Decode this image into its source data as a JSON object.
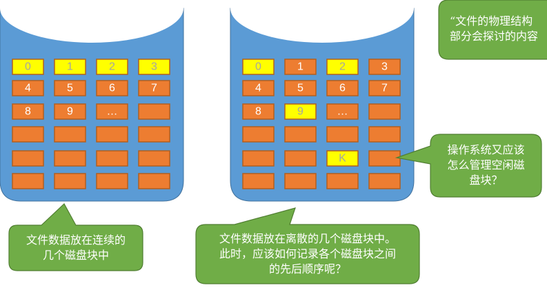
{
  "colors": {
    "disk": "#5b9bd5",
    "block_default": "#ed7d31",
    "block_highlight": "#ffff00",
    "text_on_highlight": "#a5a5a5",
    "text_on_default": "#ffffff",
    "callout": "#70ad47"
  },
  "disks": [
    {
      "name": "contiguous",
      "blocks": [
        {
          "label": "0",
          "highlight": true
        },
        {
          "label": "1",
          "highlight": true
        },
        {
          "label": "2",
          "highlight": true
        },
        {
          "label": "3",
          "highlight": true
        },
        {
          "label": "4",
          "highlight": false
        },
        {
          "label": "5",
          "highlight": false
        },
        {
          "label": "6",
          "highlight": false
        },
        {
          "label": "7",
          "highlight": false
        },
        {
          "label": "8",
          "highlight": false
        },
        {
          "label": "9",
          "highlight": false
        },
        {
          "label": "…",
          "highlight": false
        },
        {
          "label": "",
          "highlight": false
        },
        {
          "label": "",
          "highlight": false
        },
        {
          "label": "",
          "highlight": false
        },
        {
          "label": "",
          "highlight": false
        },
        {
          "label": "",
          "highlight": false
        },
        {
          "label": "",
          "highlight": false
        },
        {
          "label": "",
          "highlight": false
        },
        {
          "label": "",
          "highlight": false
        },
        {
          "label": "",
          "highlight": false
        },
        {
          "label": "",
          "highlight": false
        },
        {
          "label": "",
          "highlight": false
        },
        {
          "label": "",
          "highlight": false
        },
        {
          "label": "",
          "highlight": false
        }
      ]
    },
    {
      "name": "scattered",
      "blocks": [
        {
          "label": "0",
          "highlight": true
        },
        {
          "label": "1",
          "highlight": false
        },
        {
          "label": "2",
          "highlight": true
        },
        {
          "label": "3",
          "highlight": false
        },
        {
          "label": "4",
          "highlight": false
        },
        {
          "label": "5",
          "highlight": false
        },
        {
          "label": "6",
          "highlight": false
        },
        {
          "label": "7",
          "highlight": false
        },
        {
          "label": "8",
          "highlight": false
        },
        {
          "label": "9",
          "highlight": true
        },
        {
          "label": "…",
          "highlight": false
        },
        {
          "label": "",
          "highlight": false
        },
        {
          "label": "",
          "highlight": false
        },
        {
          "label": "",
          "highlight": false
        },
        {
          "label": "",
          "highlight": false
        },
        {
          "label": "",
          "highlight": false
        },
        {
          "label": "",
          "highlight": false
        },
        {
          "label": "",
          "highlight": false
        },
        {
          "label": "K",
          "highlight": true
        },
        {
          "label": "",
          "highlight": false
        },
        {
          "label": "",
          "highlight": false
        },
        {
          "label": "",
          "highlight": false
        },
        {
          "label": "",
          "highlight": false
        },
        {
          "label": "",
          "highlight": false
        }
      ]
    }
  ],
  "callouts": {
    "top_right": "“文件的物理结构\n部分会探讨的内容",
    "contiguous": "文件数据放在连续的\n几个磁盘块中",
    "scattered": "文件数据放在离散的几个磁盘块中。\n此时，应该如何记录各个磁盘块之间\n的先后顺序呢？",
    "free_space": "操作系统又应该\n怎么管理空闲磁\n盘块？"
  }
}
